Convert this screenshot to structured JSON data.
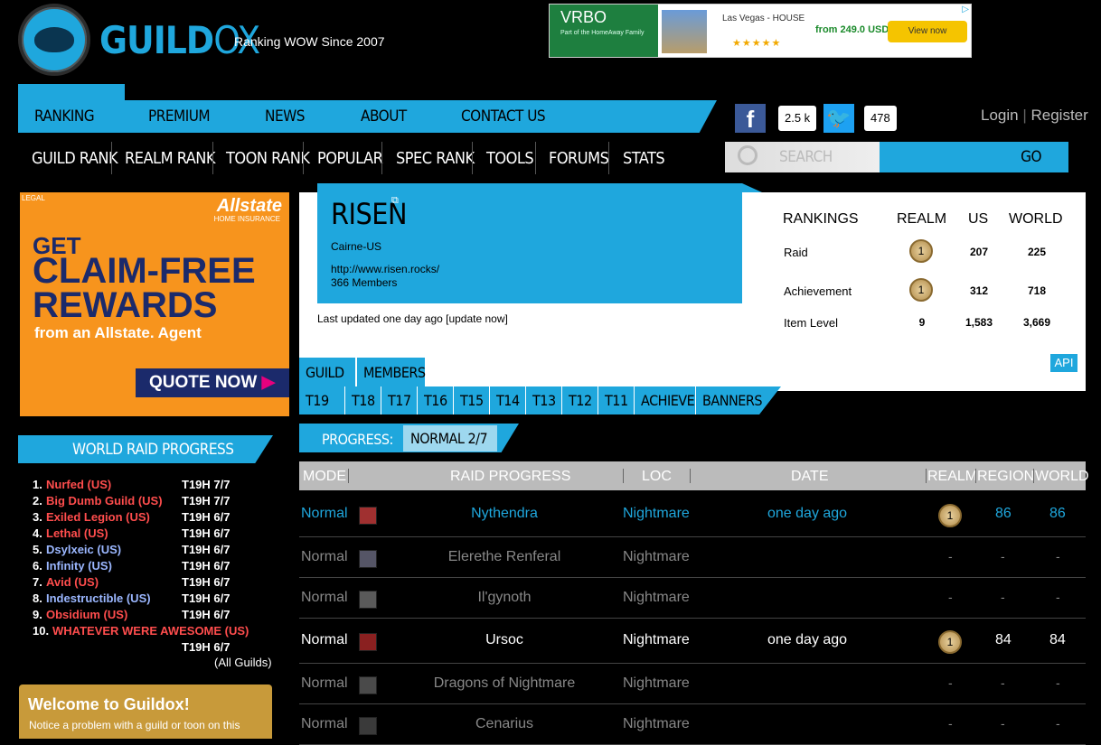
{
  "header": {
    "logo_word_a": "GUILD",
    "logo_word_b": "OX",
    "tagline": "Ranking WOW Since 2007"
  },
  "top_ad": {
    "brand": "VRBO",
    "brand_sub": "Part of the HomeAway Family",
    "location": "Las Vegas - HOUSE",
    "stars": "★★★★★",
    "price": "from 249.0 USD",
    "cta": "View now"
  },
  "nav_main": [
    "RANKING",
    "PREMIUM",
    "NEWS",
    "ABOUT",
    "CONTACT US"
  ],
  "nav_sub": [
    "GUILD RANK",
    "REALM RANK",
    "TOON RANK",
    "POPULAR",
    "SPEC RANK",
    "TOOLS",
    "FORUMS",
    "STATS"
  ],
  "social": {
    "fb_glyph": "f",
    "fb_count": "2.5 k",
    "tw_glyph": "🐦",
    "tw_count": "478"
  },
  "auth": {
    "login": "Login",
    "register": "Register",
    "sep": "|"
  },
  "search": {
    "placeholder": "SEARCH",
    "go": "GO"
  },
  "left_ad": {
    "legal": "LEGAL",
    "brand": "Allstate",
    "brand_sub": "HOME INSURANCE",
    "line1": "GET",
    "line2": "CLAIM-FREE",
    "line3": "REWARDS",
    "line4": "from an Allstate. Agent",
    "cta": "QUOTE NOW",
    "cta_arrow": "▶"
  },
  "world_raid_progress": {
    "title": "WORLD RAID PROGRESS",
    "rows": [
      {
        "rank": "1.",
        "name": "Nurfed (US)",
        "progress": "T19H 7/7",
        "color": "#ff4d4d"
      },
      {
        "rank": "2.",
        "name": "Big Dumb Guild (US)",
        "progress": "T19H 7/7",
        "color": "#ff4d4d"
      },
      {
        "rank": "3.",
        "name": "Exiled Legion (US)",
        "progress": "T19H 6/7",
        "color": "#ff4d4d"
      },
      {
        "rank": "4.",
        "name": "Lethal (US)",
        "progress": "T19H 6/7",
        "color": "#ff4d4d"
      },
      {
        "rank": "5.",
        "name": "Dsylxeic (US)",
        "progress": "T19H 6/7",
        "color": "#9bb7ff"
      },
      {
        "rank": "6.",
        "name": "Infinity (US)",
        "progress": "T19H 6/7",
        "color": "#9bb7ff"
      },
      {
        "rank": "7.",
        "name": "Avid (US)",
        "progress": "T19H 6/7",
        "color": "#ff4d4d"
      },
      {
        "rank": "8.",
        "name": "Indestructible (US)",
        "progress": "T19H 6/7",
        "color": "#9bb7ff"
      },
      {
        "rank": "9.",
        "name": "Obsidium (US)",
        "progress": "T19H 6/7",
        "color": "#ff4d4d"
      },
      {
        "rank": "10.",
        "name": "WHATEVER WERE AWESOME (US)",
        "progress": "T19H 6/7",
        "color": "#ff4d4d"
      }
    ],
    "all_link": "(All Guilds)"
  },
  "welcome": {
    "title": "Welcome to Guildox!",
    "text": "Notice a problem with a guild or toon on this"
  },
  "guild": {
    "name": "RISEN",
    "ext_glyph": "⧉",
    "realm": "Cairne-US",
    "url": "http://www.risen.rocks/",
    "members": "366 Members",
    "updated": "Last updated one day ago [update now]"
  },
  "rankings": {
    "headers": [
      "RANKINGS",
      "REALM",
      "US",
      "WORLD"
    ],
    "rows": [
      {
        "label": "Raid",
        "realm": "1",
        "us": "207",
        "world": "225"
      },
      {
        "label": "Achievement",
        "realm": "1",
        "us": "312",
        "world": "718"
      },
      {
        "label": "Item Level",
        "realm": "9",
        "us": "1,583",
        "world": "3,669"
      }
    ],
    "api": "API"
  },
  "tabs": {
    "guild": "GUILD",
    "members": "MEMBERS"
  },
  "tiers": [
    "T19",
    "T18",
    "T17",
    "T16",
    "T15",
    "T14",
    "T13",
    "T12",
    "T11",
    "ACHIEVE",
    "BANNERS"
  ],
  "progress": {
    "label": "PROGRESS:",
    "value": "NORMAL 2/7"
  },
  "raid_table": {
    "headers": [
      "MODE",
      "RAID PROGRESS",
      "LOC",
      "DATE",
      "REALM",
      "REGION",
      "WORLD"
    ],
    "rows": [
      {
        "mode": "Normal",
        "boss": "Nythendra",
        "loc": "Nightmare",
        "date": "one day ago",
        "realm": "1",
        "region": "86",
        "world": "86",
        "state": "latest"
      },
      {
        "mode": "Normal",
        "boss": "Elerethe Renferal",
        "loc": "Nightmare",
        "date": "",
        "realm": "-",
        "region": "-",
        "world": "-",
        "state": "pending"
      },
      {
        "mode": "Normal",
        "boss": "Il'gynoth",
        "loc": "Nightmare",
        "date": "",
        "realm": "-",
        "region": "-",
        "world": "-",
        "state": "pending"
      },
      {
        "mode": "Normal",
        "boss": "Ursoc",
        "loc": "Nightmare",
        "date": "one day ago",
        "realm": "1",
        "region": "84",
        "world": "84",
        "state": "killed"
      },
      {
        "mode": "Normal",
        "boss": "Dragons of Nightmare",
        "loc": "Nightmare",
        "date": "",
        "realm": "-",
        "region": "-",
        "world": "-",
        "state": "pending"
      },
      {
        "mode": "Normal",
        "boss": "Cenarius",
        "loc": "Nightmare",
        "date": "",
        "realm": "-",
        "region": "-",
        "world": "-",
        "state": "pending"
      }
    ]
  },
  "colors": {
    "accent": "#1fa7dd",
    "latest_text": "#1fa7dd",
    "pending_text": "#888888",
    "killed_text": "#ffffff"
  }
}
